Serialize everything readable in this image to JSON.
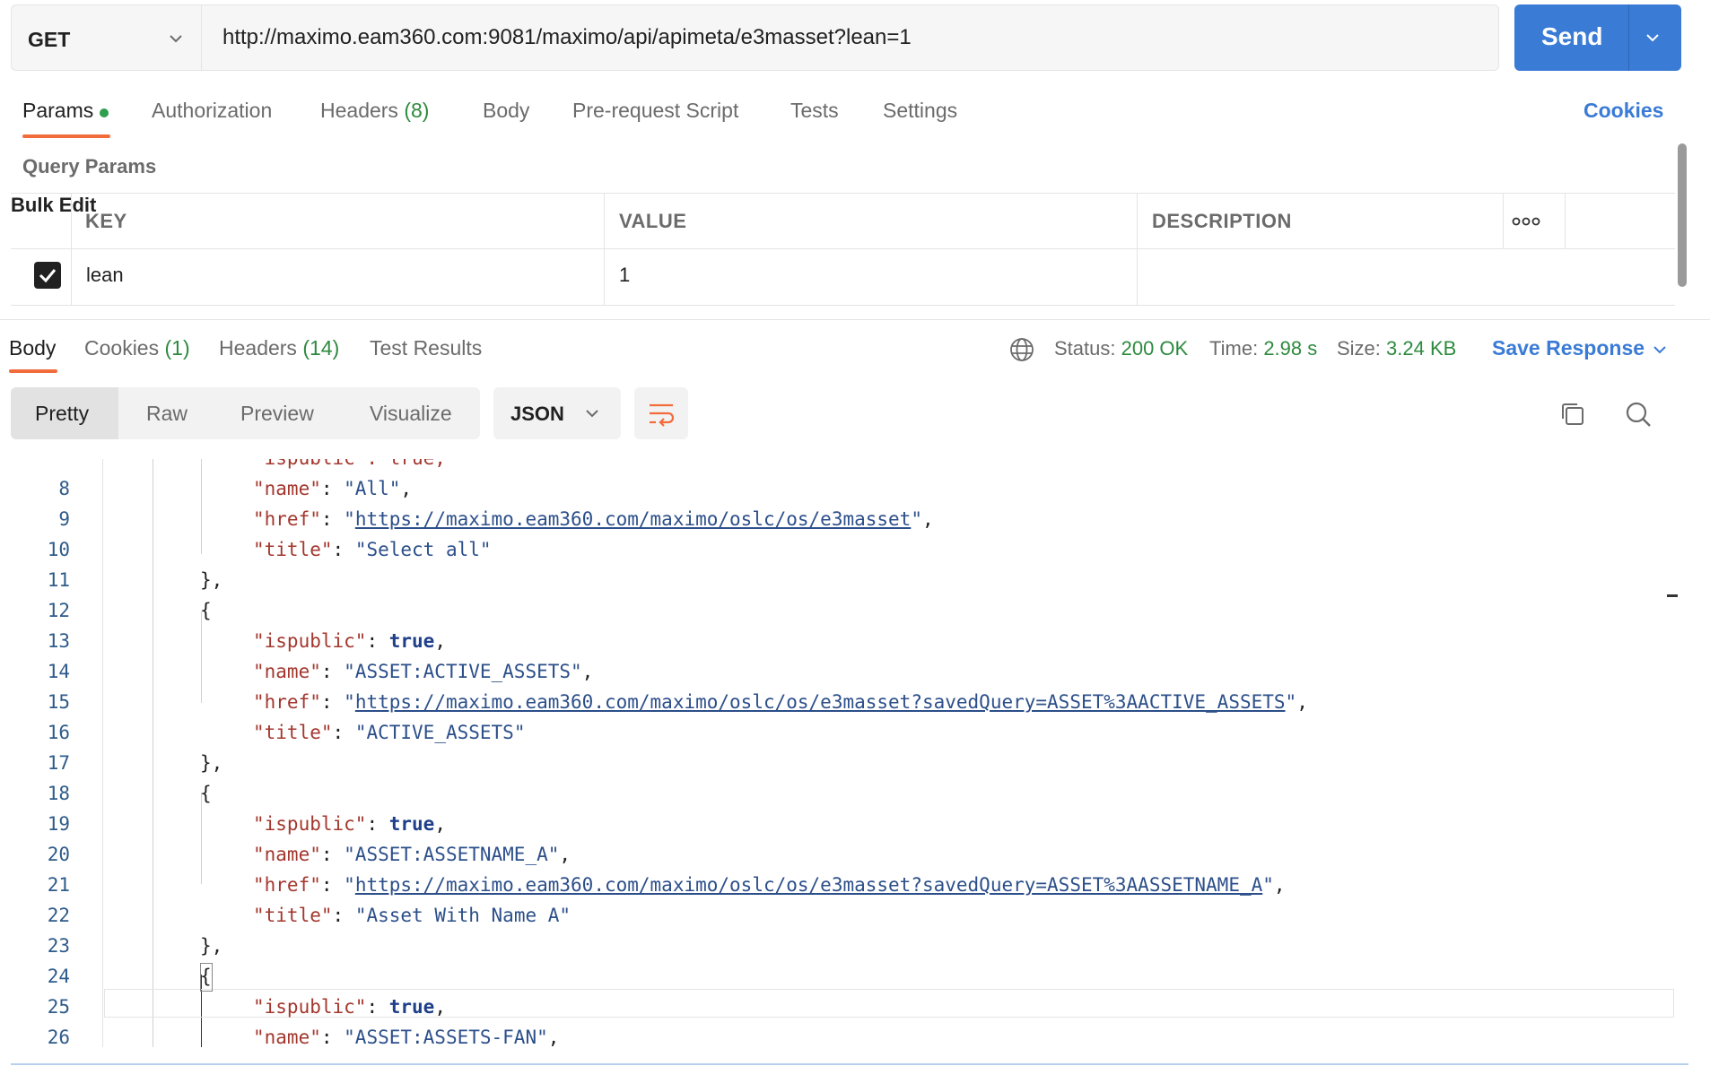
{
  "request": {
    "method": "GET",
    "url": "http://maximo.eam360.com:9081/maximo/api/apimeta/e3masset?lean=1",
    "send_label": "Send"
  },
  "request_tabs": {
    "params": "Params",
    "authorization": "Authorization",
    "headers": "Headers",
    "headers_count": "(8)",
    "body": "Body",
    "prerequest": "Pre-request Script",
    "tests": "Tests",
    "settings": "Settings",
    "cookies": "Cookies"
  },
  "query_params": {
    "title": "Query Params",
    "columns": [
      "KEY",
      "VALUE",
      "DESCRIPTION"
    ],
    "bulk_edit": "Bulk Edit",
    "rows": [
      {
        "key": "lean",
        "value": "1",
        "description": "",
        "checked": true
      }
    ]
  },
  "response_tabs": {
    "body": "Body",
    "cookies": "Cookies",
    "cookies_count": "(1)",
    "headers": "Headers",
    "headers_count": "(14)",
    "test_results": "Test Results"
  },
  "status": {
    "status_label": "Status:",
    "status_value": "200 OK",
    "time_label": "Time:",
    "time_value": "2.98 s",
    "size_label": "Size:",
    "size_value": "3.24 KB",
    "save_response": "Save Response"
  },
  "view": {
    "modes": [
      "Pretty",
      "Raw",
      "Preview",
      "Visualize"
    ],
    "active_mode": "Pretty",
    "format": "JSON"
  },
  "code": {
    "partial_top": "\"ispublic\": true,",
    "lines": [
      {
        "n": "8",
        "indent": 3,
        "key": "name",
        "value": "All",
        "type": "string",
        "comma": true
      },
      {
        "n": "9",
        "indent": 3,
        "key": "href",
        "value": "https://maximo.eam360.com/maximo/oslc/os/e3masset",
        "type": "url",
        "comma": true
      },
      {
        "n": "10",
        "indent": 3,
        "key": "title",
        "value": "Select all",
        "type": "string",
        "comma": false
      },
      {
        "n": "11",
        "indent": 2,
        "punct": "},"
      },
      {
        "n": "12",
        "indent": 2,
        "punct": "{"
      },
      {
        "n": "13",
        "indent": 3,
        "key": "ispublic",
        "value": "true",
        "type": "bool",
        "comma": true
      },
      {
        "n": "14",
        "indent": 3,
        "key": "name",
        "value": "ASSET:ACTIVE_ASSETS",
        "type": "string",
        "comma": true
      },
      {
        "n": "15",
        "indent": 3,
        "key": "href",
        "value": "https://maximo.eam360.com/maximo/oslc/os/e3masset?savedQuery=ASSET%3AACTIVE_ASSETS",
        "type": "url",
        "comma": true
      },
      {
        "n": "16",
        "indent": 3,
        "key": "title",
        "value": "ACTIVE_ASSETS",
        "type": "string",
        "comma": false
      },
      {
        "n": "17",
        "indent": 2,
        "punct": "},"
      },
      {
        "n": "18",
        "indent": 2,
        "punct": "{"
      },
      {
        "n": "19",
        "indent": 3,
        "key": "ispublic",
        "value": "true",
        "type": "bool",
        "comma": true
      },
      {
        "n": "20",
        "indent": 3,
        "key": "name",
        "value": "ASSET:ASSETNAME_A",
        "type": "string",
        "comma": true
      },
      {
        "n": "21",
        "indent": 3,
        "key": "href",
        "value": "https://maximo.eam360.com/maximo/oslc/os/e3masset?savedQuery=ASSET%3AASSETNAME_A",
        "type": "url",
        "comma": true
      },
      {
        "n": "22",
        "indent": 3,
        "key": "title",
        "value": "Asset With Name A",
        "type": "string",
        "comma": false
      },
      {
        "n": "23",
        "indent": 2,
        "punct": "},"
      },
      {
        "n": "24",
        "indent": 2,
        "punct": "{"
      },
      {
        "n": "25",
        "indent": 3,
        "key": "ispublic",
        "value": "true",
        "type": "bool",
        "comma": true
      },
      {
        "n": "26",
        "indent": 3,
        "key": "name",
        "value": "ASSET:ASSETS-FAN",
        "type": "string",
        "comma": true
      }
    ]
  },
  "icons": {
    "method_dropdown": "chevron-down-icon",
    "send_dropdown": "chevron-down-icon",
    "more": "more-horizontal-icon",
    "globe": "globe-icon",
    "wrap": "wrap-lines-icon",
    "copy": "copy-icon",
    "search": "search-icon"
  },
  "colors": {
    "accent": "#3a7bd5",
    "tab_underline": "#f26b3a",
    "status_green": "#2e8a3e"
  }
}
